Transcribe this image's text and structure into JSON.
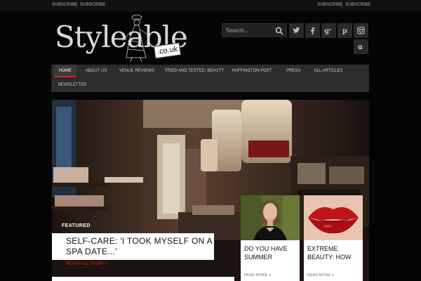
{
  "topbar": {
    "left_links": [
      "SUBSCRIBE",
      "SUBSCRIBE"
    ],
    "right_links": [
      "SUBSCRIBE",
      "SUBSCRIBE"
    ]
  },
  "logo": {
    "text": "Styleable",
    "tld": ".co.uk"
  },
  "search": {
    "placeholder": "Search..."
  },
  "social": [
    "twitter-icon",
    "facebook-icon",
    "google-plus-icon",
    "pinterest-icon",
    "instagram-icon",
    "alpha-icon"
  ],
  "nav": {
    "items": [
      "HOME",
      "ABOUT US",
      "VENUE REVIEWS",
      "TRIED AND TESTED: BEAUTY",
      "HUFFINGTON POST",
      "PRESS",
      "ALL ARTICLES",
      "NEWSLETTER"
    ],
    "active": "HOME",
    "accent": "#e02020"
  },
  "featured": {
    "label": "FEATURED",
    "title": "SELF-CARE: 'I TOOK MYSELF ON A SPA DATE...'",
    "read_more": "READ FULL STORY »"
  },
  "cards": [
    {
      "title": "DO YOU HAVE SUMMER",
      "read_more": "READ MORE"
    },
    {
      "title": "EXTREME BEAUTY: HOW",
      "read_more": "READ MORE"
    }
  ]
}
